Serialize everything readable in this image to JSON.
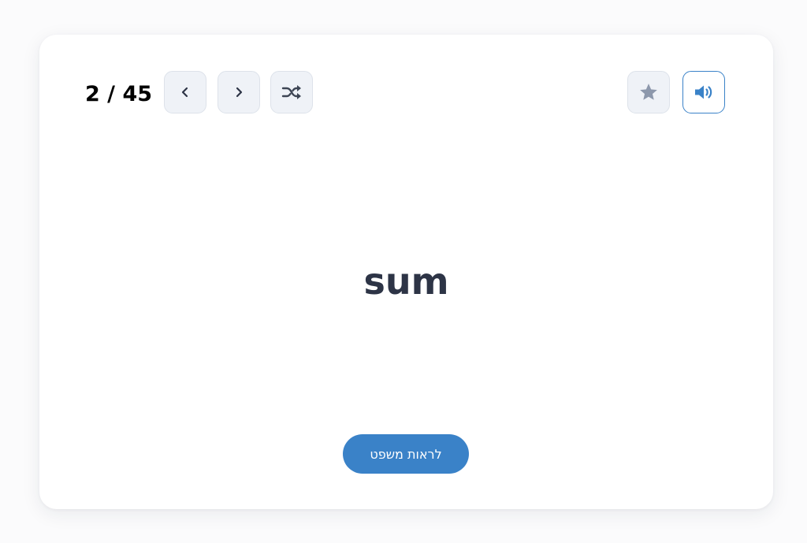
{
  "flashcard": {
    "counter": "2 / 45",
    "word": "sum",
    "show_sentence_label": "לראות משפט"
  },
  "icons": {
    "prev": "chevron-left-icon",
    "next": "chevron-right-icon",
    "shuffle": "shuffle-icon",
    "favorite": "star-icon",
    "audio": "speaker-icon"
  },
  "colors": {
    "accent": "#3a82c8",
    "word_text": "#2d3446",
    "button_bg": "#eff2f7",
    "icon_gray": "#8d98ac"
  }
}
